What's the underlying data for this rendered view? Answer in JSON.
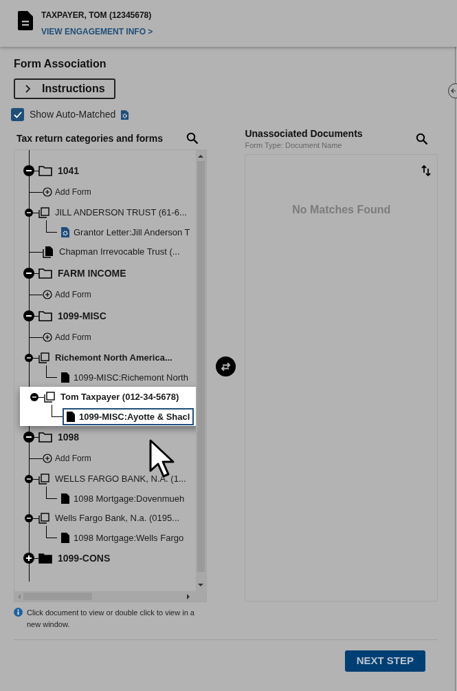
{
  "header": {
    "client": "TAXPAYER, TOM (12345678)",
    "link": "VIEW ENGAGEMENT INFO >"
  },
  "title": "Form Association",
  "instructions": {
    "label": "Instructions",
    "expanded": false
  },
  "auto_matched": {
    "label": "Show Auto-Matched",
    "checked": true
  },
  "tree_panel": {
    "title": "Tax return categories and forms",
    "nodes": [
      {
        "kind": "category",
        "label": "1041",
        "expanded": true,
        "children": [
          {
            "kind": "add",
            "label": "Add Form"
          },
          {
            "kind": "entity",
            "label": "JILL ANDERSON TRUST (61-6...",
            "expanded": true,
            "unread": false,
            "highlighted": false,
            "children": [
              {
                "kind": "document",
                "label": "Grantor Letter:Jill Anderson T",
                "auto_matched": true,
                "selected": false
              }
            ]
          },
          {
            "kind": "file",
            "label": "Chapman Irrevocable Trust (..."
          }
        ]
      },
      {
        "kind": "category",
        "label": "FARM INCOME",
        "expanded": true,
        "children": [
          {
            "kind": "add",
            "label": "Add Form"
          }
        ]
      },
      {
        "kind": "category",
        "label": "1099-MISC",
        "expanded": true,
        "children": [
          {
            "kind": "add",
            "label": "Add Form"
          },
          {
            "kind": "entity",
            "label": "Richemont North America...",
            "expanded": true,
            "unread": true,
            "highlighted": false,
            "children": [
              {
                "kind": "document",
                "label": "1099-MISC:Richemont North",
                "auto_matched": false,
                "selected": false
              }
            ]
          },
          {
            "kind": "entity",
            "label": "Tom Taxpayer (012-34-5678)",
            "expanded": true,
            "unread": true,
            "highlighted": true,
            "children": [
              {
                "kind": "document",
                "label": "1099-MISC:Ayotte & Shacl",
                "auto_matched": false,
                "selected": true
              }
            ]
          }
        ]
      },
      {
        "kind": "category",
        "label": "1098",
        "expanded": true,
        "children": [
          {
            "kind": "add",
            "label": "Add Form"
          },
          {
            "kind": "entity",
            "label": "WELLS FARGO BANK, N.A. (1...",
            "expanded": true,
            "unread": false,
            "highlighted": false,
            "children": [
              {
                "kind": "document",
                "label": "1098 Mortgage:Dovenmueh",
                "auto_matched": false,
                "selected": false
              }
            ]
          },
          {
            "kind": "entity",
            "label": "Wells Fargo Bank, N.a. (0195...",
            "expanded": true,
            "unread": false,
            "highlighted": false,
            "children": [
              {
                "kind": "document",
                "label": "1098 Mortgage:Wells Fargo",
                "auto_matched": false,
                "selected": false
              }
            ]
          }
        ]
      },
      {
        "kind": "category",
        "label": "1099-CONS",
        "expanded": false
      }
    ],
    "hint": "Click document to view or double click to view in a new window."
  },
  "documents_panel": {
    "title": "Unassociated Documents",
    "subtitle": "Form Type: Document Name",
    "empty_text": "No Matches Found"
  },
  "next_button": "NEXT STEP"
}
